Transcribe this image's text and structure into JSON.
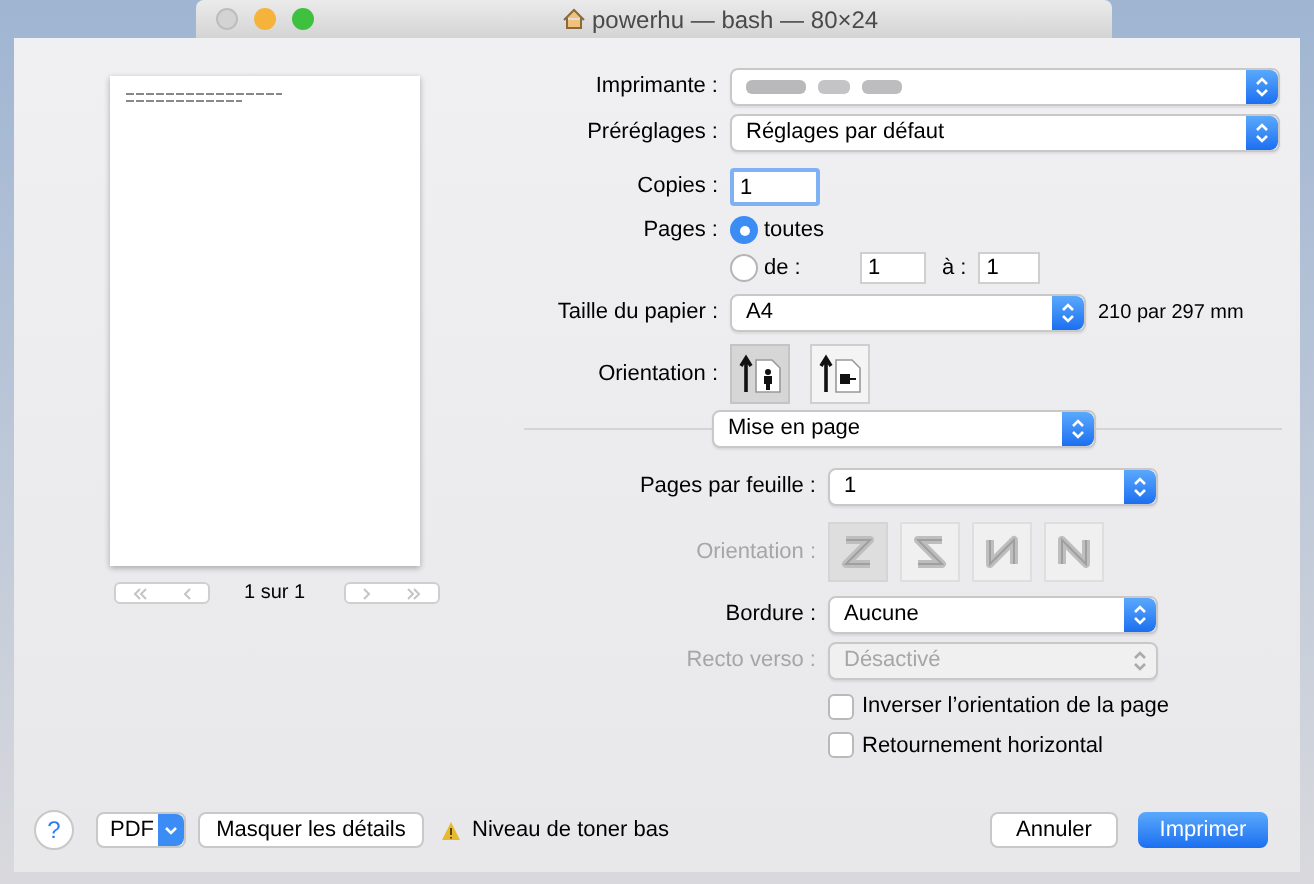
{
  "window": {
    "title": "powerhu — bash — 80×24"
  },
  "preview": {
    "pager": "1 sur 1"
  },
  "printer": {
    "label": "Imprimante :"
  },
  "presets": {
    "label": "Préréglages :",
    "value": "Réglages par défaut"
  },
  "copies": {
    "label": "Copies :",
    "value": "1"
  },
  "pages": {
    "label": "Pages :",
    "options": [
      {
        "label": "toutes",
        "selected": true
      },
      {
        "label": "de :",
        "selected": false
      }
    ],
    "from": "1",
    "to_label": "à :",
    "to": "1"
  },
  "paper_size": {
    "label": "Taille du papier :",
    "value": "A4",
    "dimensions": "210 par 297 mm"
  },
  "orientation": {
    "label": "Orientation :",
    "options": [
      {
        "kind": "portrait",
        "selected": true
      },
      {
        "kind": "landscape",
        "selected": false
      }
    ]
  },
  "section": {
    "value": "Mise en page"
  },
  "layout": {
    "pages_per_sheet": {
      "label": "Pages par feuille :",
      "value": "1"
    },
    "direction": {
      "label": "Orientation :",
      "disabled": true,
      "options": [
        {
          "kind": "z",
          "selected": true
        },
        {
          "kind": "s",
          "selected": false
        },
        {
          "kind": "n_reverse",
          "selected": false
        },
        {
          "kind": "n",
          "selected": false
        }
      ]
    },
    "border": {
      "label": "Bordure :",
      "value": "Aucune"
    },
    "duplex": {
      "label": "Recto verso :",
      "value": "Désactivé",
      "disabled": true
    },
    "checkboxes": [
      {
        "label": "Inverser l’orientation de la page",
        "checked": false
      },
      {
        "label": "Retournement horizontal",
        "checked": false
      }
    ]
  },
  "footer": {
    "help": "?",
    "pdf": "PDF",
    "details_button": "Masquer les détails",
    "warning": "Niveau de toner bas",
    "cancel": "Annuler",
    "print": "Imprimer"
  }
}
